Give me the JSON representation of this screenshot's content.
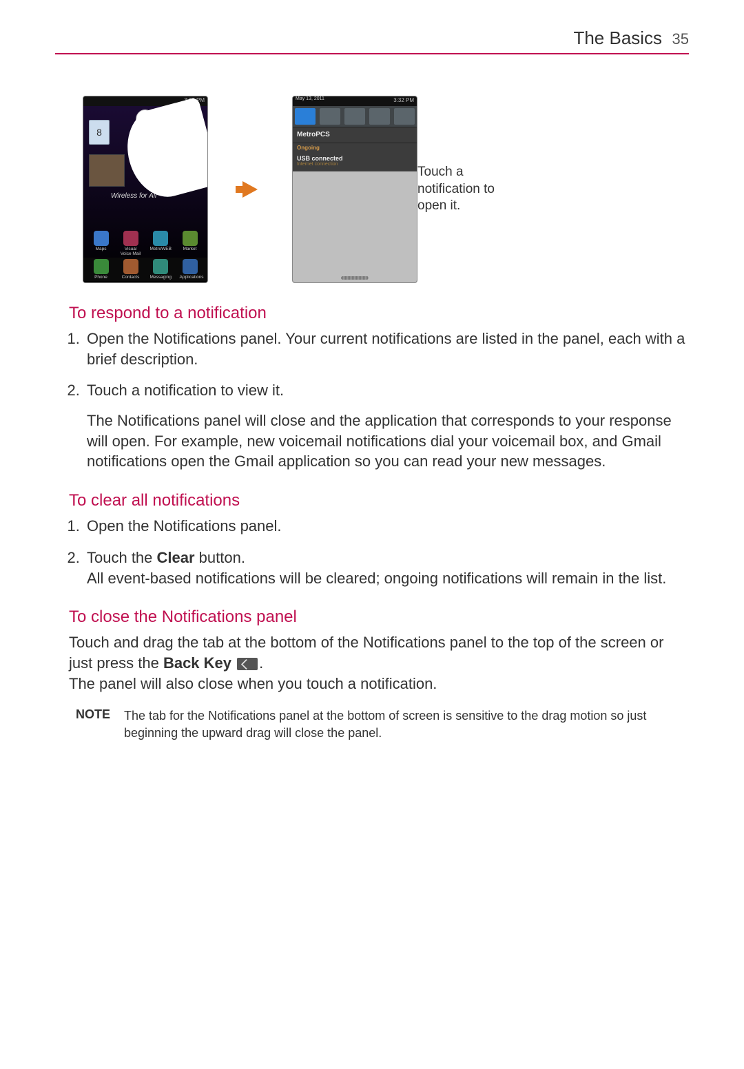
{
  "header": {
    "chapter": "The Basics",
    "page": "35"
  },
  "figure": {
    "statusbar_time": "3:32 PM",
    "phone1": {
      "clock_digit": "8",
      "banner_text": "Wireless for All",
      "apps_row1": [
        {
          "label": "Maps",
          "color": "#3a77c9"
        },
        {
          "label": "Visual Voice Mail",
          "color": "#a03050"
        },
        {
          "label": "MetroWEB",
          "color": "#2a8aa8"
        },
        {
          "label": "Market",
          "color": "#5a8a30"
        }
      ],
      "apps_row2": [
        {
          "label": "Phone",
          "color": "#3a8a3a"
        },
        {
          "label": "Contacts",
          "color": "#a05a30"
        },
        {
          "label": "Messaging",
          "color": "#308a7a"
        },
        {
          "label": "Applications",
          "color": "#3060a0"
        }
      ]
    },
    "phone2": {
      "date": "May 13, 2011",
      "carrier": "MetroPCS",
      "section": "Ongoing",
      "item_title": "USB connected",
      "item_sub": "Internet connection"
    },
    "callout": "Touch a notification to open it."
  },
  "sections": {
    "respond": {
      "heading": "To respond to a notification",
      "step1": "Open the Notifications panel. Your current notifications are listed in the panel, each with a brief description.",
      "step2": "Touch a notification to view it.",
      "step2_detail": "The Notifications panel will close and the application that corresponds to your response will open. For example, new voicemail notifications dial your voicemail box, and Gmail notifications open the Gmail application so you can read your new messages."
    },
    "clear": {
      "heading": "To clear all notifications",
      "step1": "Open the Notifications panel.",
      "step2_pre": "Touch the ",
      "step2_bold": "Clear",
      "step2_post": " button.",
      "step2_detail": "All event-based notifications will be cleared; ongoing notifications will remain in the list."
    },
    "close": {
      "heading": "To close the Notifications panel",
      "para1_pre": "Touch and drag the tab at the bottom of the Notifications panel to the top of the screen or just press the ",
      "para1_bold": "Back Key",
      "para1_post": ".",
      "para2": "The panel will also close when you touch a notification."
    },
    "note": {
      "label": "NOTE",
      "text": "The tab for the Notifications panel at the bottom of screen is sensitive to the drag motion so just beginning the upward drag will close the panel."
    }
  }
}
